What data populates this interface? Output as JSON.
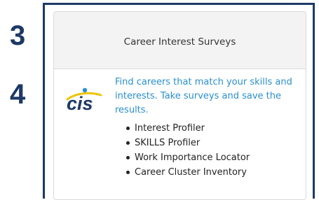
{
  "steps": {
    "three": "3",
    "four": "4"
  },
  "card": {
    "title": "Career Interest Surveys",
    "logo_text": "cis",
    "description": "Find careers that match your skills and interests. Take surveys and save the results.",
    "surveys": [
      "Interest Profiler",
      "SKILLS Profiler",
      "Work Importance Locator",
      "Career Cluster Inventory"
    ]
  },
  "colors": {
    "step_number": "#1d3967",
    "frame": "#1d3967",
    "link": "#2a8fcf",
    "logo_text": "#1d3967",
    "logo_swoosh": "#f2c300"
  }
}
